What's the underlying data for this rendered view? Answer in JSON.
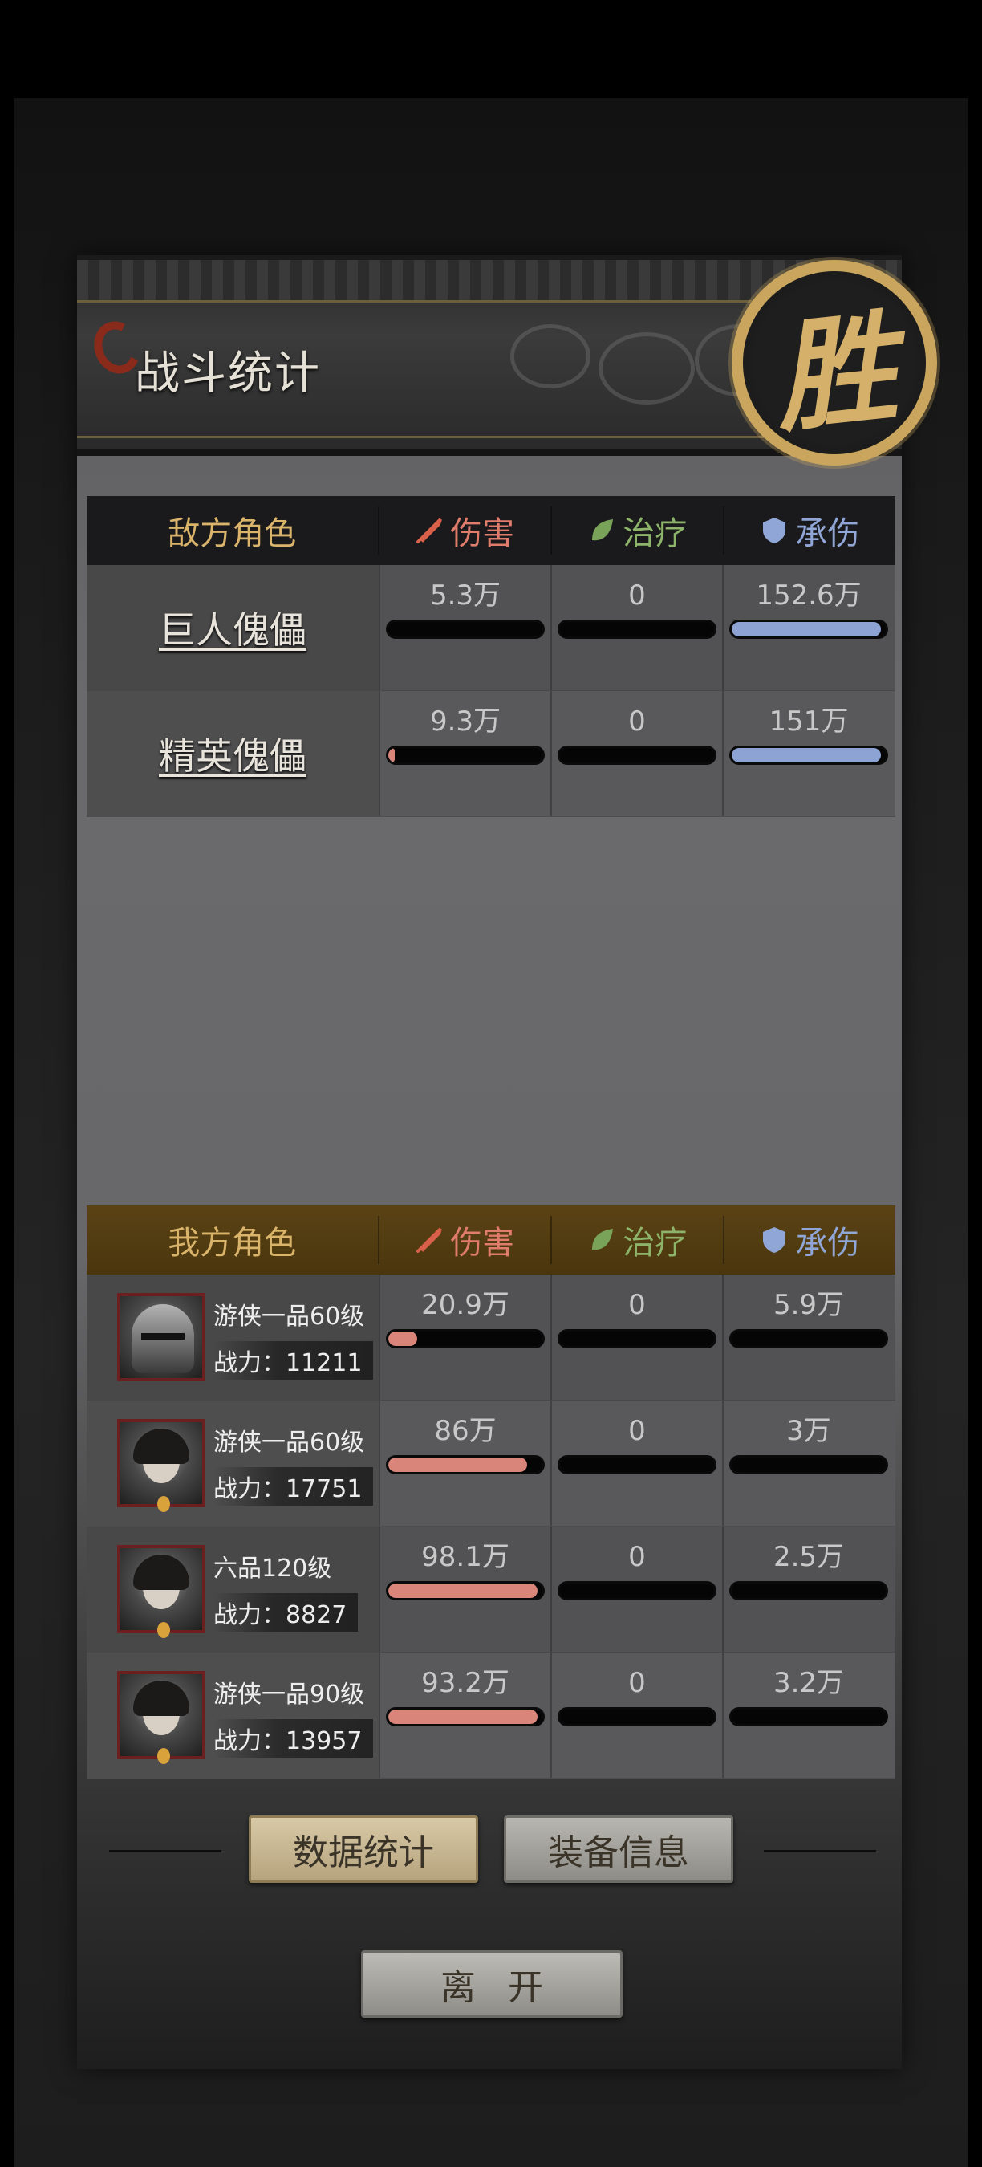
{
  "header": {
    "title": "战斗统计",
    "seal_char": "胜"
  },
  "columns": {
    "damage": "伤害",
    "heal": "治疗",
    "taken": "承伤"
  },
  "enemy": {
    "label": "敌方角色",
    "rows": [
      {
        "name": "巨人傀儡",
        "damage": "5.3万",
        "heal": "0",
        "taken": "152.6万",
        "damage_frac": 0.0,
        "heal_frac": 0.0,
        "taken_frac": 0.97
      },
      {
        "name": "精英傀儡",
        "damage": "9.3万",
        "heal": "0",
        "taken": "151万",
        "damage_frac": 0.04,
        "heal_frac": 0.0,
        "taken_frac": 0.97
      }
    ]
  },
  "ally": {
    "label": "我方角色",
    "rows": [
      {
        "avatar": "helmet",
        "cls": "游侠一品60级",
        "power": "战力：11211",
        "damage": "20.9万",
        "heal": "0",
        "taken": "5.9万",
        "damage_frac": 0.19,
        "heal_frac": 0.0,
        "taken_frac": 0.0
      },
      {
        "avatar": "girl",
        "cls": "游侠一品60级",
        "power": "战力：17751",
        "damage": "86万",
        "heal": "0",
        "taken": "3万",
        "damage_frac": 0.9,
        "heal_frac": 0.0,
        "taken_frac": 0.0
      },
      {
        "avatar": "woman",
        "cls": "六品120级",
        "power": "战力：8827",
        "damage": "98.1万",
        "heal": "0",
        "taken": "2.5万",
        "damage_frac": 0.97,
        "heal_frac": 0.0,
        "taken_frac": 0.0
      },
      {
        "avatar": "cat-girl",
        "cls": "游侠一品90级",
        "power": "战力：13957",
        "damage": "93.2万",
        "heal": "0",
        "taken": "3.2万",
        "damage_frac": 0.97,
        "heal_frac": 0.0,
        "taken_frac": 0.0
      }
    ]
  },
  "buttons": {
    "stats": "数据统计",
    "equip": "装备信息",
    "leave": "离开"
  },
  "colors": {
    "damage": "#d9857a",
    "heal": "#8db46a",
    "taken": "#8ca3d4",
    "title_gold": "#d9b46a"
  }
}
